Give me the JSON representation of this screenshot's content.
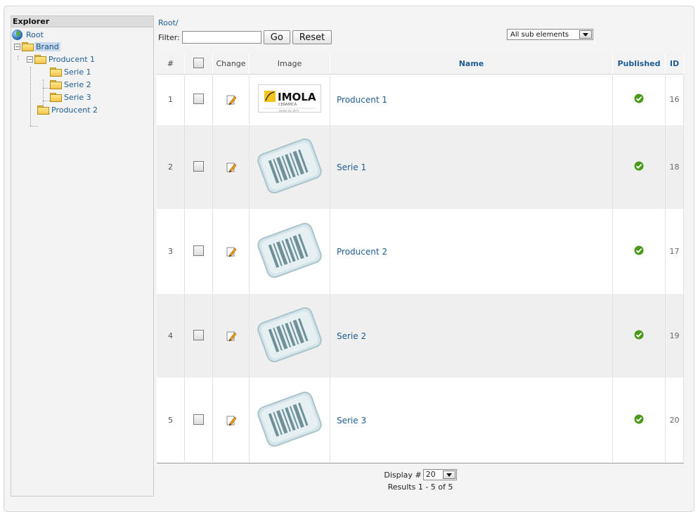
{
  "explorer": {
    "title": "Explorer",
    "tree": [
      {
        "label": "Root",
        "icon": "globe-icon"
      },
      {
        "label": "Brand",
        "icon": "folder-icon",
        "selected": true,
        "expander": "−"
      },
      {
        "label": "Producent 1",
        "icon": "folder-icon",
        "expander": "−"
      },
      {
        "label": "Serie 1",
        "icon": "folder-icon"
      },
      {
        "label": "Serie 2",
        "icon": "folder-icon"
      },
      {
        "label": "Serie 3",
        "icon": "folder-icon"
      },
      {
        "label": "Producent 2",
        "icon": "folder-icon"
      }
    ]
  },
  "breadcrumb": "Root/",
  "filter": {
    "label": "Filter:",
    "value": "",
    "go_label": "Go",
    "reset_label": "Reset"
  },
  "sub_elements_select": {
    "selected": "All sub elements"
  },
  "table": {
    "headers": {
      "num": "#",
      "change": "Change",
      "image": "Image",
      "name": "Name",
      "published": "Published",
      "id": "ID"
    },
    "rows": [
      {
        "num": "1",
        "name": "Producent 1",
        "id": "16",
        "image": "logo",
        "published": true
      },
      {
        "num": "2",
        "name": "Serie 1",
        "id": "18",
        "image": "barcode",
        "published": true
      },
      {
        "num": "3",
        "name": "Producent 2",
        "id": "17",
        "image": "barcode",
        "published": true
      },
      {
        "num": "4",
        "name": "Serie 2",
        "id": "19",
        "image": "barcode",
        "published": true
      },
      {
        "num": "5",
        "name": "Serie 3",
        "id": "20",
        "image": "barcode",
        "published": true
      }
    ]
  },
  "logo": {
    "brand": "IMOLA",
    "sub": "CERAMICA",
    "tagline": "ltalian dal 1874"
  },
  "pagination": {
    "display_label": "Display #",
    "display_value": "20",
    "results": "Results 1 - 5 of 5"
  },
  "colors": {
    "link": "#1e5d93",
    "published_green": "#4a9a1a",
    "selected_bg": "#c4d8ee"
  }
}
